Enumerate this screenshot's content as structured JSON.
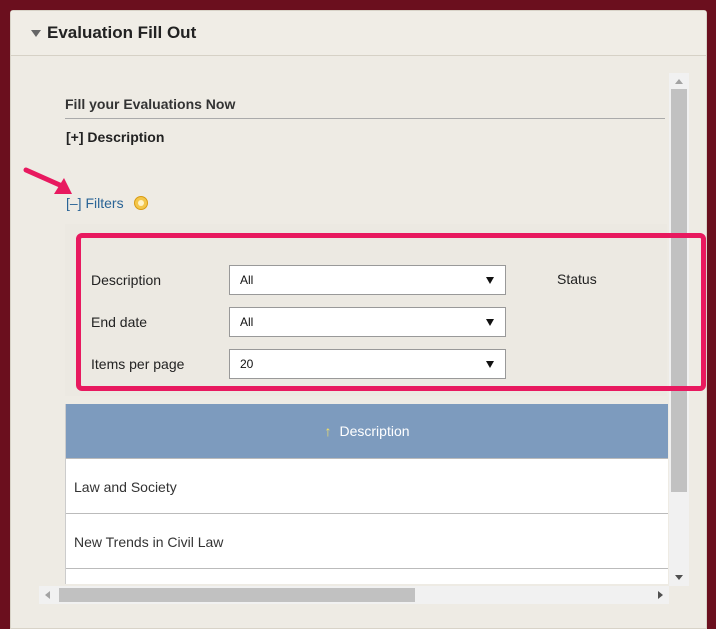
{
  "panel": {
    "title": "Evaluation Fill Out"
  },
  "section": {
    "title": "Fill your Evaluations Now",
    "description_toggle": "[+] Description",
    "filters_toggle": "[–] Filters"
  },
  "filters": {
    "description": {
      "label": "Description",
      "value": "All"
    },
    "end_date": {
      "label": "End date",
      "value": "All"
    },
    "items_per_page": {
      "label": "Items per page",
      "value": "20"
    },
    "status": {
      "label": "Status"
    }
  },
  "table": {
    "header": {
      "sort_icon": "↑",
      "label": "Description"
    },
    "rows": [
      "Law and Society",
      "New Trends in Civil Law"
    ]
  },
  "annotation": {
    "color": "#e8195f"
  },
  "colors": {
    "background": "#6b0f1e",
    "table_header": "#7d9bbe",
    "link": "#2a6496"
  }
}
